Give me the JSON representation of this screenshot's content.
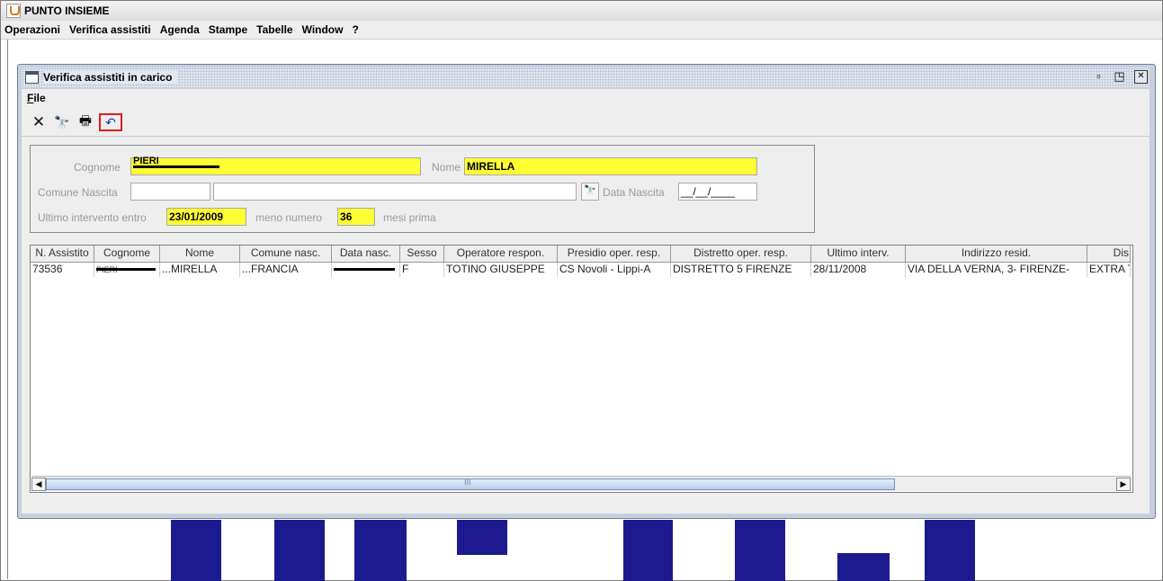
{
  "app": {
    "title": "PUNTO INSIEME"
  },
  "menubar": [
    "Operazioni",
    "Verifica assistiti",
    "Agenda",
    "Stampe",
    "Tabelle",
    "Window",
    "?"
  ],
  "internal_window": {
    "title": "Verifica assistiti in carico",
    "menu": {
      "file_label": "ile",
      "file_mnemonic": "F"
    },
    "toolbar_icons": [
      "close-x-icon",
      "binoculars-icon",
      "printer-icon",
      "undo-icon"
    ],
    "highlight_color": "#e01b1b"
  },
  "search": {
    "cognome_label": "Cognome",
    "cognome_value": "PIERI",
    "nome_label": "Nome",
    "nome_value": "MIRELLA",
    "comune_label": "Comune Nascita",
    "comune_code": "",
    "comune_name": "",
    "data_nascita_label": "Data Nascita",
    "data_nascita_value": "__/__/____",
    "ultimo_label": "Ultimo intervento entro",
    "ultimo_value": "23/01/2009",
    "meno_label": "meno numero",
    "meno_value": "36",
    "mesi_label": "mesi prima",
    "field_highlight_color": "#ffff33"
  },
  "table": {
    "columns": [
      "N. Assistito",
      "Cognome",
      "Nome",
      "Comune nasc.",
      "Data nasc.",
      "Sesso",
      "Operatore respon.",
      "Presidio oper. resp.",
      "Distretto oper. resp.",
      "Ultimo interv.",
      "Indirizzo resid.",
      "Dis"
    ],
    "rows": [
      {
        "n_assistito": "73536",
        "cognome": "PIERI",
        "nome": "...MIRELLA",
        "comune": "...FRANCIA",
        "data_nasc": "",
        "sesso": "F",
        "operatore": "TOTINO GIUSEPPE",
        "presidio": "CS Novoli - Lippi-A",
        "distretto": "DISTRETTO 5 FIRENZE",
        "ultimo": "28/11/2008",
        "indirizzo": "VIA DELLA VERNA, 3- FIRENZE-",
        "dis": "EXTRA T"
      }
    ]
  },
  "scrollbar": {
    "grip": "III"
  },
  "colors": {
    "desktop_block": "#1c1a8e",
    "frame_border": "#6f7f9c"
  }
}
